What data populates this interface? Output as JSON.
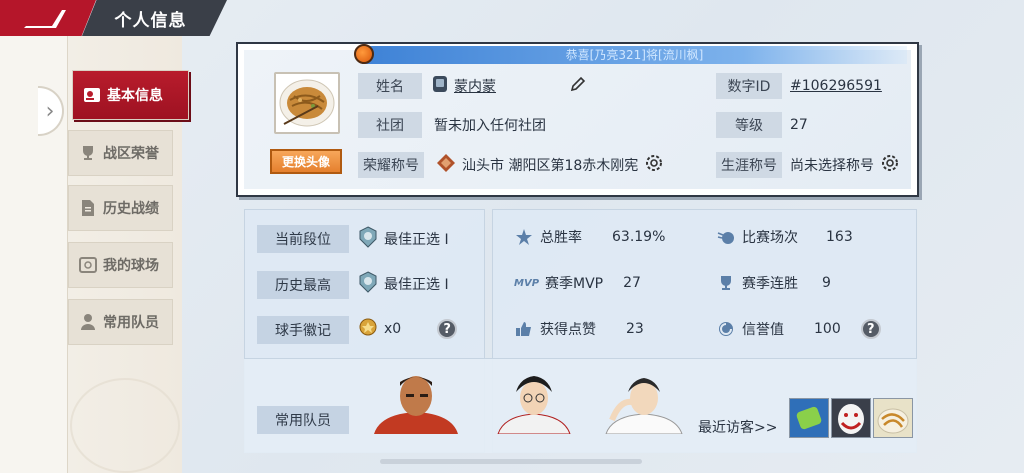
{
  "header": {
    "title": "个人信息"
  },
  "sidebar": {
    "items": [
      {
        "label": "基本信息",
        "icon": "user-card-icon",
        "active": true
      },
      {
        "label": "战区荣誉",
        "icon": "trophy-icon",
        "active": false
      },
      {
        "label": "历史战绩",
        "icon": "document-icon",
        "active": false
      },
      {
        "label": "我的球场",
        "icon": "court-icon",
        "active": false
      },
      {
        "label": "常用队员",
        "icon": "person-icon",
        "active": false
      }
    ]
  },
  "ticker": {
    "text": "恭喜[乃亮321]将[流川枫]"
  },
  "profile": {
    "change_avatar": "更换头像",
    "name_label": "姓名",
    "name_value": "蒙内蒙",
    "club_label": "社团",
    "club_value": "暂未加入任何社团",
    "honor_label": "荣耀称号",
    "honor_value": "汕头市 潮阳区第18赤木刚宪",
    "id_label": "数字ID",
    "id_value": "#106296591",
    "level_label": "等级",
    "level_value": "27",
    "career_label": "生涯称号",
    "career_value": "尚未选择称号"
  },
  "rank": {
    "current_label": "当前段位",
    "current_value": "最佳正选 I",
    "best_label": "历史最高",
    "best_value": "最佳正选 I",
    "badge_label": "球手徽记",
    "badge_value": "x0"
  },
  "stats": {
    "winrate_label": "总胜率",
    "winrate_value": "63.19%",
    "matches_label": "比赛场次",
    "matches_value": "163",
    "mvp_icon_text": "MVP",
    "mvp_label": "赛季MVP",
    "mvp_value": "27",
    "streak_label": "赛季连胜",
    "streak_value": "9",
    "likes_label": "获得点赞",
    "likes_value": "23",
    "credit_label": "信誉值",
    "credit_value": "100"
  },
  "team": {
    "label": "常用队员",
    "visitors_label": "最近访客>>"
  },
  "colors": {
    "brand_red": "#b5162a",
    "header_dark": "#3a3f48",
    "ticker_blue": "#3e82d6",
    "button_orange": "#e5802e"
  }
}
